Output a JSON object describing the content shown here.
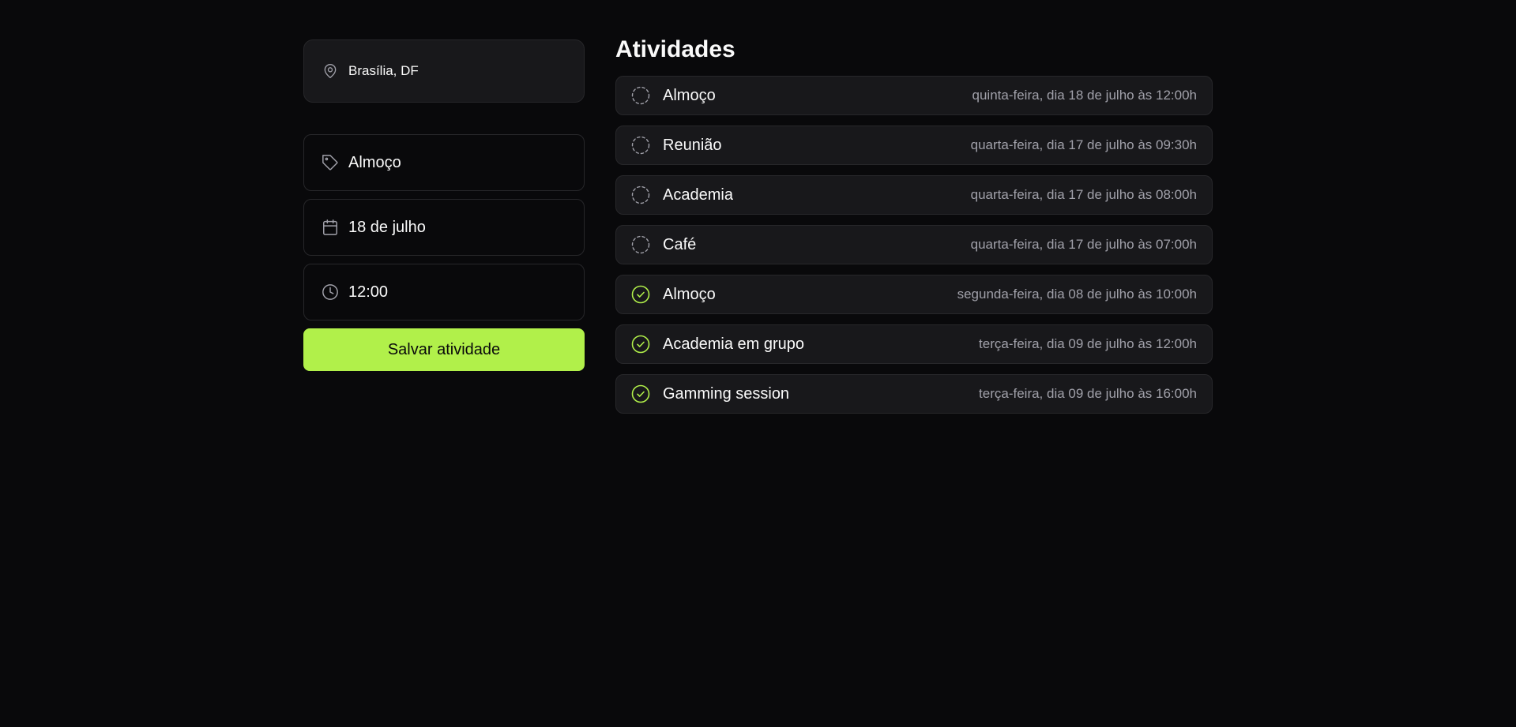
{
  "location": {
    "label": "Brasília, DF",
    "icon": "map-pin-icon"
  },
  "form": {
    "name_value": "Almoço",
    "date_value": "18 de julho",
    "time_value": "12:00",
    "save_label": "Salvar atividade"
  },
  "colors": {
    "accent": "#b1f04a",
    "background": "#09090b",
    "card": "#18181b",
    "border": "#27272a",
    "muted_text": "#a1a1aa"
  },
  "activities": {
    "title": "Atividades",
    "items": [
      {
        "name": "Almoço",
        "when": "quinta-feira, dia 18 de julho às 12:00h",
        "status": "pending"
      },
      {
        "name": "Reunião",
        "when": "quarta-feira, dia 17 de julho às 09:30h",
        "status": "pending"
      },
      {
        "name": "Academia",
        "when": "quarta-feira, dia 17 de julho às 08:00h",
        "status": "pending"
      },
      {
        "name": "Café",
        "when": "quarta-feira, dia 17 de julho às 07:00h",
        "status": "pending"
      },
      {
        "name": "Almoço",
        "when": "segunda-feira, dia 08 de julho às 10:00h",
        "status": "done"
      },
      {
        "name": "Academia em grupo",
        "when": "terça-feira, dia 09 de julho às 12:00h",
        "status": "done"
      },
      {
        "name": "Gamming session",
        "when": "terça-feira, dia 09 de julho às 16:00h",
        "status": "done"
      }
    ]
  }
}
